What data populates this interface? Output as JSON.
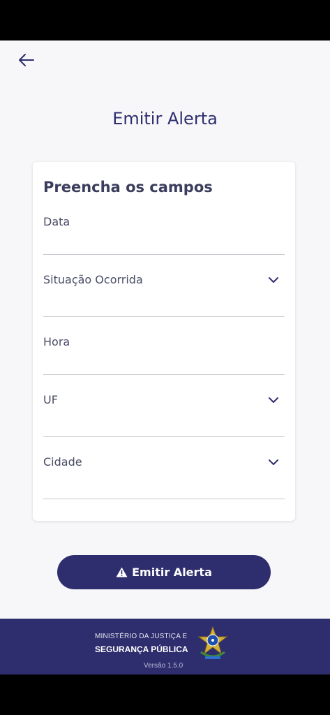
{
  "header": {
    "title": "Emitir Alerta"
  },
  "form": {
    "title": "Preencha os campos",
    "fields": [
      {
        "label": "Data",
        "type": "date"
      },
      {
        "label": "Situação Ocorrida",
        "type": "select"
      },
      {
        "label": "Hora",
        "type": "time"
      },
      {
        "label": "UF",
        "type": "select"
      },
      {
        "label": "Cidade",
        "type": "select"
      }
    ]
  },
  "action": {
    "submit_label": "Emitir Alerta"
  },
  "footer": {
    "org_line1": "MINISTÉRIO DA JUSTIÇA E",
    "org_line2": "SEGURANÇA PÚBLICA",
    "version": "Versão 1.5.0"
  },
  "colors": {
    "primary": "#2e2e6e",
    "background": "#f7f7fa",
    "card": "#ffffff"
  },
  "icons": {
    "back": "arrow-left-icon",
    "dropdown": "chevron-down-icon",
    "warning": "warning-triangle-icon",
    "emblem": "brazil-coat-of-arms"
  }
}
